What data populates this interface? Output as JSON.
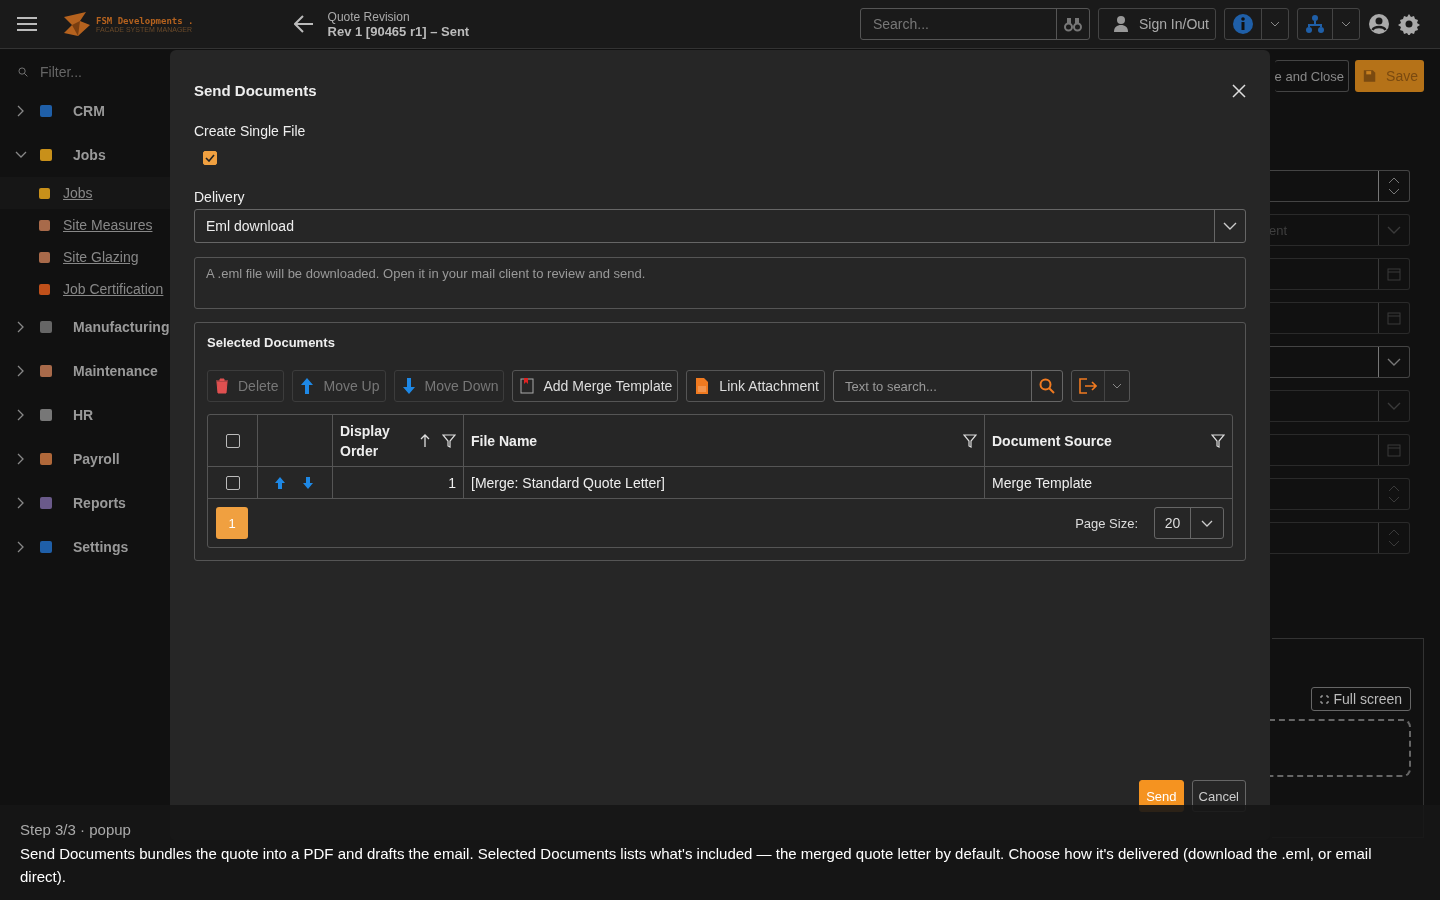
{
  "topbar": {
    "logo_name": "FSM Developments .",
    "logo_tagline": "FACADE SYSTEM MANAGER",
    "subtitle": "Quote Revision",
    "title": "Rev 1 [90465 r1] – Sent",
    "search": {
      "placeholder": "Search..."
    },
    "sign_in": "Sign In/Out"
  },
  "sidebar": {
    "filter": {
      "placeholder": "Filter..."
    },
    "items": [
      {
        "label": "CRM",
        "expanded": false
      },
      {
        "label": "Jobs",
        "expanded": true,
        "children": [
          {
            "label": "Jobs",
            "selected": true
          },
          {
            "label": "Site Measures",
            "selected": false
          },
          {
            "label": "Site Glazing",
            "selected": false
          },
          {
            "label": "Job Certification",
            "selected": false
          }
        ]
      },
      {
        "label": "Manufacturing",
        "expanded": false
      },
      {
        "label": "Maintenance",
        "expanded": false
      },
      {
        "label": "HR",
        "expanded": false
      },
      {
        "label": "Payroll",
        "expanded": false
      },
      {
        "label": "Reports",
        "expanded": false
      },
      {
        "label": "Settings",
        "expanded": false
      }
    ]
  },
  "background": {
    "save_close": "e and Close",
    "save": "Save",
    "fields": [
      {
        "kind": "spin",
        "disabled": false
      },
      {
        "kind": "select",
        "value": "ent",
        "disabled": true
      },
      {
        "kind": "date",
        "disabled": true
      },
      {
        "kind": "date",
        "disabled": true
      },
      {
        "kind": "select",
        "disabled": false
      },
      {
        "kind": "select",
        "disabled": true
      },
      {
        "kind": "date",
        "disabled": true
      },
      {
        "kind": "spin",
        "disabled": true
      },
      {
        "kind": "spin",
        "disabled": true
      }
    ],
    "full_screen": "Full screen"
  },
  "dialog": {
    "title": "Send Documents",
    "single_file": {
      "label": "Create Single File",
      "checked": true
    },
    "delivery": {
      "label": "Delivery",
      "value": "Eml download"
    },
    "note": "A .eml file will be downloaded. Open it in your mail client to review and send.",
    "selected_documents": {
      "title": "Selected Documents",
      "toolbar": [
        {
          "kind": "delete",
          "label": "Delete",
          "disabled": true
        },
        {
          "kind": "up",
          "label": "Move Up",
          "disabled": true
        },
        {
          "kind": "down",
          "label": "Move Down",
          "disabled": true
        },
        {
          "kind": "template",
          "label": "Add Merge Template",
          "disabled": false
        },
        {
          "kind": "attach",
          "label": "Link Attachment",
          "disabled": false
        }
      ],
      "search": {
        "placeholder": "Text to search..."
      },
      "select_all": {
        "checked": false
      },
      "columns": [
        {
          "label": "Display Order",
          "sorted": true,
          "filter": true
        },
        {
          "label": "File Name",
          "sorted": false,
          "filter": true
        },
        {
          "label": "Document Source",
          "sorted": false,
          "filter": true
        }
      ],
      "rows": [
        {
          "checked": false,
          "order": "1",
          "file_name": "[Merge: Standard Quote Letter]",
          "source": "Merge Template"
        }
      ],
      "pages": [
        {
          "label": "1",
          "selected": true
        }
      ],
      "page_size_label": "Page Size:",
      "page_size": "20"
    },
    "buttons": [
      {
        "kind": "primary",
        "label": "Send"
      },
      {
        "kind": "secondary",
        "label": "Cancel"
      }
    ]
  },
  "caption": {
    "step": "Step 3/3 · popup",
    "text": "Send Documents bundles the quote into a PDF and drafts the email. Selected Documents lists what's included — the merged quote letter by default. Choose how it's delivered (download the .eml, or email direct)."
  }
}
